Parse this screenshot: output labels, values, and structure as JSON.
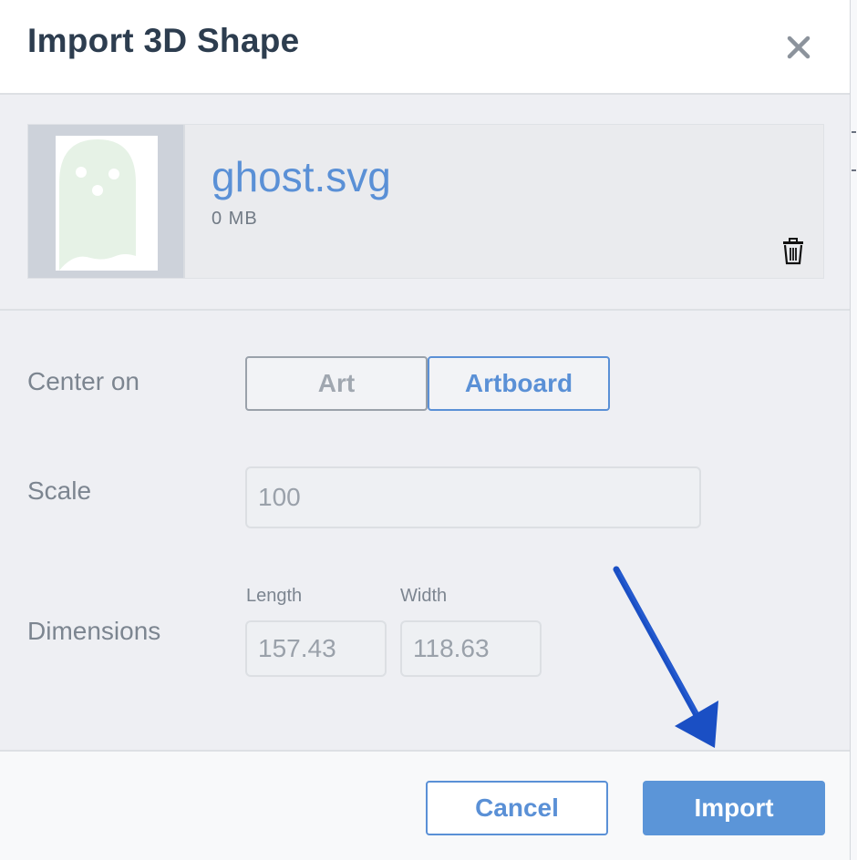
{
  "dialog": {
    "title": "Import 3D Shape",
    "close_icon": "close-icon"
  },
  "file": {
    "name": "ghost.svg",
    "size": "0 MB",
    "thumbnail_icon": "ghost-icon",
    "delete_icon": "trash-icon"
  },
  "form": {
    "center_on": {
      "label": "Center on",
      "options": [
        "Art",
        "Artboard"
      ],
      "selected": "Artboard"
    },
    "scale": {
      "label": "Scale",
      "value": "100"
    },
    "dimensions": {
      "label": "Dimensions",
      "length_label": "Length",
      "length_value": "157.43",
      "width_label": "Width",
      "width_value": "118.63"
    }
  },
  "footer": {
    "cancel_label": "Cancel",
    "import_label": "Import"
  },
  "colors": {
    "accent": "#5a90d6",
    "primary_button": "#5b95d8",
    "title_text": "#2d3d4f",
    "annotation_arrow": "#1a4fc4",
    "ghost_fill": "#e6f2e6"
  }
}
